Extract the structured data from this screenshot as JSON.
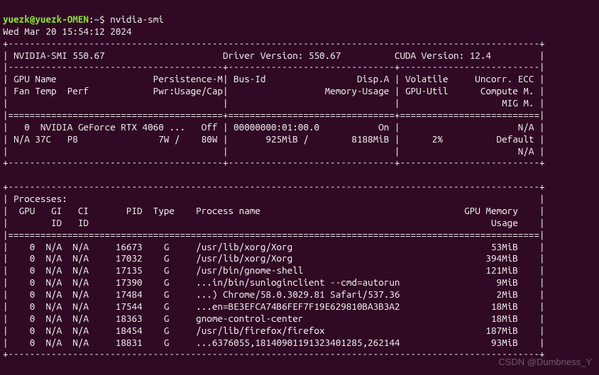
{
  "prompt": {
    "user": "yuezk",
    "host": "yuezk-OMEN",
    "path": "~",
    "symbol": "$"
  },
  "command": "nvidia-smi",
  "timestamp": "Wed Mar 20 15:54:12 2024",
  "header": {
    "smi_label": "NVIDIA-SMI",
    "smi_version": "550.67",
    "driver_label": "Driver Version:",
    "driver_version": "550.67",
    "cuda_label": "CUDA Version:",
    "cuda_version": "12.4"
  },
  "columns": {
    "gpu": "GPU",
    "name": "Name",
    "persistence": "Persistence-M",
    "fan": "Fan",
    "temp": "Temp",
    "perf": "Perf",
    "pwr": "Pwr:Usage/Cap",
    "busid": "Bus-Id",
    "dispa": "Disp.A",
    "memusage": "Memory-Usage",
    "volatile": "Volatile",
    "uncorr": "Uncorr. ECC",
    "gpuutil": "GPU-Util",
    "compute": "Compute M.",
    "mig": "MIG M."
  },
  "gpus": [
    {
      "index": "0",
      "name": "NVIDIA GeForce RTX 4060 ...",
      "persistence": "Off",
      "busid": "00000000:01:00.0",
      "dispa": "On",
      "ecc": "N/A",
      "fan": "N/A",
      "temp": "37C",
      "perf": "P8",
      "pwr_usage": "7W",
      "pwr_cap": "80W",
      "mem_used": "925MiB",
      "mem_total": "8188MiB",
      "util": "2%",
      "compute": "Default",
      "mig": "N/A"
    }
  ],
  "proc_header": {
    "title": "Processes:",
    "gpu": "GPU",
    "gi": "GI",
    "ci": "CI",
    "pid": "PID",
    "type": "Type",
    "pname": "Process name",
    "gmem": "GPU Memory",
    "id": "ID",
    "usage": "Usage"
  },
  "processes": [
    {
      "gpu": "0",
      "gi": "N/A",
      "ci": "N/A",
      "pid": "16673",
      "type": "G",
      "name": "/usr/lib/xorg/Xorg",
      "mem": "53MiB"
    },
    {
      "gpu": "0",
      "gi": "N/A",
      "ci": "N/A",
      "pid": "17032",
      "type": "G",
      "name": "/usr/lib/xorg/Xorg",
      "mem": "394MiB"
    },
    {
      "gpu": "0",
      "gi": "N/A",
      "ci": "N/A",
      "pid": "17135",
      "type": "G",
      "name": "/usr/bin/gnome-shell",
      "mem": "121MiB"
    },
    {
      "gpu": "0",
      "gi": "N/A",
      "ci": "N/A",
      "pid": "17390",
      "type": "G",
      "name": "...in/bin/sunloginclient --cmd=autorun",
      "mem": "9MiB"
    },
    {
      "gpu": "0",
      "gi": "N/A",
      "ci": "N/A",
      "pid": "17484",
      "type": "G",
      "name": "...) Chrome/58.0.3029.81 Safari/537.36",
      "mem": "2MiB"
    },
    {
      "gpu": "0",
      "gi": "N/A",
      "ci": "N/A",
      "pid": "17544",
      "type": "G",
      "name": "...en=BE3EFCA74B6FEF7F19E629810BA3B3A2",
      "mem": "18MiB"
    },
    {
      "gpu": "0",
      "gi": "N/A",
      "ci": "N/A",
      "pid": "18363",
      "type": "G",
      "name": "gnome-control-center",
      "mem": "18MiB"
    },
    {
      "gpu": "0",
      "gi": "N/A",
      "ci": "N/A",
      "pid": "18454",
      "type": "G",
      "name": "/usr/lib/firefox/firefox",
      "mem": "187MiB"
    },
    {
      "gpu": "0",
      "gi": "N/A",
      "ci": "N/A",
      "pid": "18831",
      "type": "G",
      "name": "...6376055,18140901191323401285,262144",
      "mem": "93MiB"
    }
  ],
  "watermark": "CSDN @Dumbness_Y"
}
